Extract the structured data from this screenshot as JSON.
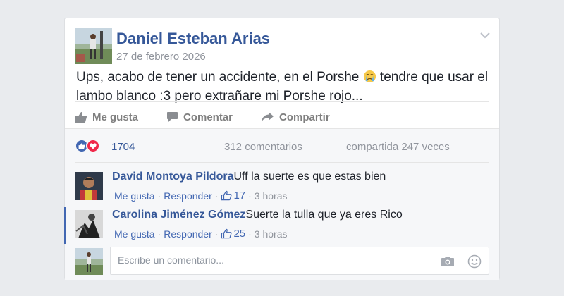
{
  "post": {
    "author": "Daniel Esteban Arias",
    "date": "27 de febrero 2026",
    "text_before_emoji": "Ups, acabo de tener un accidente, en el Porshe ",
    "emoji": "crying-face-emoji",
    "text_after_emoji": " tendre que usar el lambo blanco :3 pero extrañare mi Porshe rojo..."
  },
  "actions": {
    "like": "Me gusta",
    "comment": "Comentar",
    "share": "Compartir"
  },
  "stats": {
    "reactions": "1704",
    "comments": "312 comentarios",
    "shares": "compartida 247 veces"
  },
  "comments": [
    {
      "author": "David Montoya Pildora",
      "text": "Uff la suerte es que estas bien",
      "like_label": "Me gusta",
      "reply_label": "Responder",
      "likes": "17",
      "time": "3 horas"
    },
    {
      "author": "Carolina Jiménez Gómez",
      "text": "Suerte la tulla que ya eres Rico",
      "like_label": "Me gusta",
      "reply_label": "Responder",
      "likes": "25",
      "time": "3 horas"
    }
  ],
  "comment_input": {
    "placeholder": "Escribe un comentario..."
  },
  "colors": {
    "link_blue": "#365899",
    "fb_blue": "#4267b2",
    "love_red": "#f0284a"
  }
}
